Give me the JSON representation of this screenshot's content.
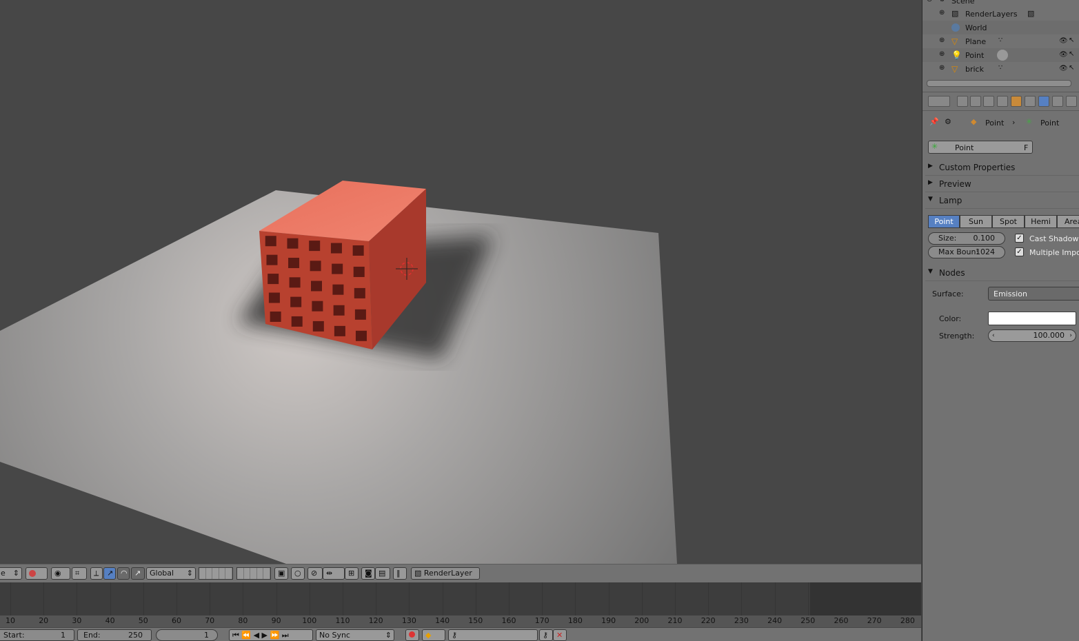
{
  "outliner": {
    "scene_label": "Scene",
    "items": [
      {
        "name": "RenderLayers"
      },
      {
        "name": "World"
      },
      {
        "name": "Plane"
      },
      {
        "name": "Point"
      },
      {
        "name": "brick"
      }
    ]
  },
  "properties": {
    "breadcrumb": {
      "first": "Point",
      "second": "Point"
    },
    "datablock": {
      "name": "Point",
      "fake_user": "F"
    },
    "sections": {
      "custom_properties": "Custom Properties",
      "preview": "Preview",
      "lamp": "Lamp",
      "nodes": "Nodes"
    },
    "lamp_types": [
      "Point",
      "Sun",
      "Spot",
      "Hemi",
      "Area"
    ],
    "active_lamp_type": "Point",
    "size": {
      "label": "Size:",
      "value": "0.100"
    },
    "max_bounces": {
      "label": "Max Boun:",
      "value": "1024"
    },
    "cast_shadow": "Cast Shadow",
    "multiple_importance": "Multiple Impor",
    "surface": {
      "label": "Surface:",
      "value": "Emission"
    },
    "color": {
      "label": "Color:",
      "value": "#ffffff"
    },
    "strength": {
      "label": "Strength:",
      "value": "100.000"
    }
  },
  "viewport_header": {
    "orientation": "Global",
    "render_layer": "RenderLayer",
    "mode_fragment": "e"
  },
  "timeline": {
    "ticks": [
      "10",
      "20",
      "30",
      "40",
      "50",
      "60",
      "70",
      "80",
      "90",
      "100",
      "110",
      "120",
      "130",
      "140",
      "150",
      "160",
      "170",
      "180",
      "190",
      "200",
      "210",
      "220",
      "230",
      "240",
      "250",
      "260",
      "270",
      "280"
    ],
    "start": {
      "label": "Start:",
      "value": "1"
    },
    "end": {
      "label": "End:",
      "value": "250"
    },
    "current": "1",
    "sync": "No Sync"
  },
  "colors": {
    "brick": "#c8503e",
    "accent": "#5680c2",
    "viewport_bg": "#474747"
  }
}
